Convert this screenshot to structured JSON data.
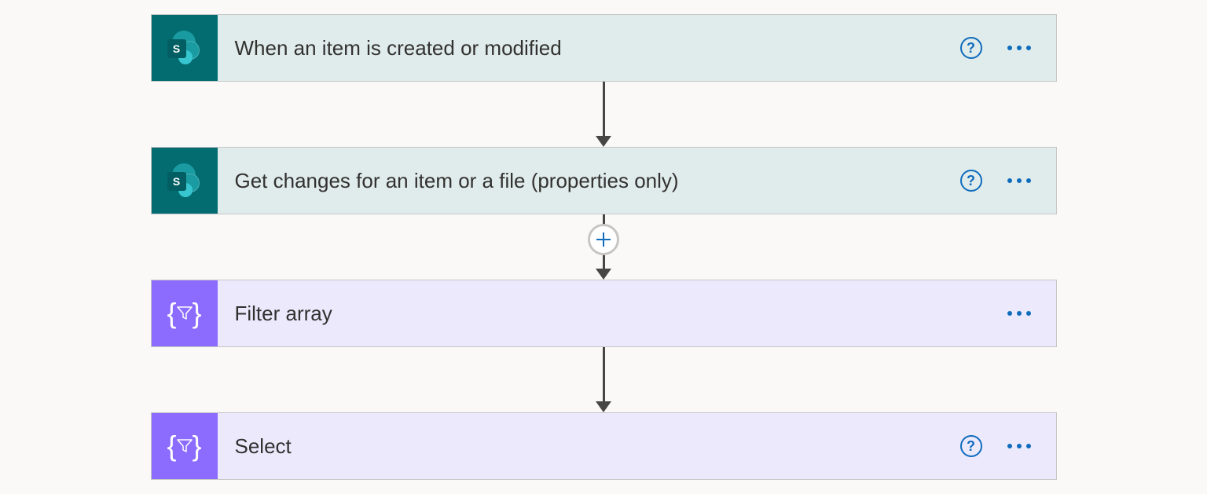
{
  "steps": [
    {
      "title": "When an item is created or modified",
      "type": "sharepoint",
      "hasHelp": true
    },
    {
      "title": "Get changes for an item or a file (properties only)",
      "type": "sharepoint",
      "hasHelp": true
    },
    {
      "title": "Filter array",
      "type": "dataop",
      "hasHelp": false
    },
    {
      "title": "Select",
      "type": "dataop",
      "hasHelp": true
    }
  ],
  "glyph": {
    "sharepoint_letter": "S",
    "help_symbol": "?"
  },
  "connectors": {
    "addButtonOnIndex": 1
  }
}
